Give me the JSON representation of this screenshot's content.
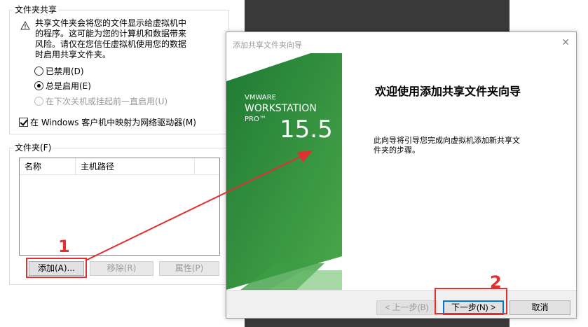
{
  "settings": {
    "sharing_group_title": "文件夹共享",
    "warning_lines": [
      "共享文件夹会将您的文件显示给虚拟机中",
      "的程序。这可能为您的计算机和数据带来",
      "风险。请仅在您信任虚拟机使用您的数据",
      "时启用共享文件夹。"
    ],
    "radio_disabled": "已禁用(D)",
    "radio_always": "总是启用(E)",
    "radio_until_off": "在下次关机或挂起前一直启用(U)",
    "map_drive_label": "在 Windows 客户机中映射为网络驱动器(M)",
    "folders_group_title": "文件夹(F)",
    "columns": [
      "名称",
      "主机路径"
    ],
    "add_label": "添加(A)...",
    "remove_label": "移除(R)",
    "properties_label": "属性(P)"
  },
  "dialog": {
    "title": "添加共享文件夹向导",
    "close_glyph": "✕",
    "banner": {
      "brand": "VMWARE",
      "product": "WORKSTATION",
      "edition": "PRO™",
      "version": "15.5"
    },
    "welcome_title": "欢迎使用添加共享文件夹向导",
    "description_lines": [
      "此向导将引导您完成向虚拟机添加新共享文",
      "件夹的步骤。"
    ],
    "back_label": "< 上一步(B)",
    "next_label": "下一步(N) >",
    "cancel_label": "取消"
  },
  "annotations": {
    "step1": "1",
    "step2": "2",
    "color": "#e03030"
  },
  "colors": {
    "banner_green": "#2e8b3a",
    "focus_blue": "#0078d7"
  }
}
